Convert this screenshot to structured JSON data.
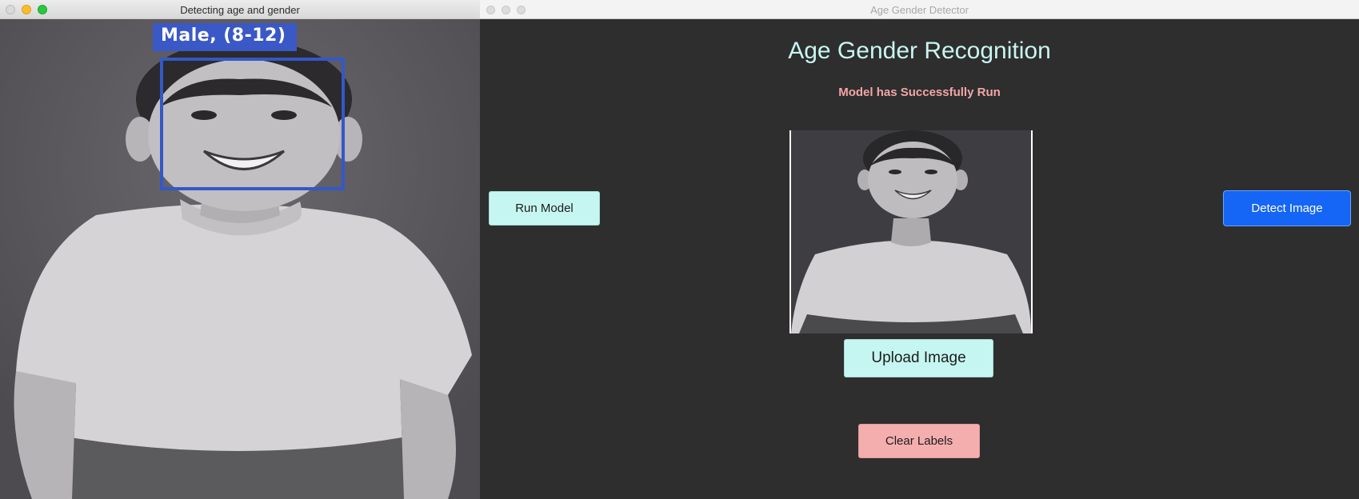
{
  "left_window": {
    "title": "Detecting age and gender",
    "detection_label": "Male, (8-12)",
    "colors": {
      "box": "#3358c8",
      "label_bg": "#3a58c6"
    }
  },
  "right_window": {
    "title": "Age Gender Detector",
    "heading": "Age Gender Recognition",
    "status": "Model has Successfully Run",
    "buttons": {
      "run_model": "Run Model",
      "upload_image": "Upload Image",
      "detect_image": "Detect Image",
      "clear_labels": "Clear Labels"
    },
    "colors": {
      "background": "#2e2e2e",
      "heading": "#c8f5f0",
      "status": "#f3a6a6",
      "teal_button": "#c6f6f1",
      "pink_button": "#f5aeae",
      "blue_button": "#1565f6"
    },
    "preview_image": "child-portrait"
  },
  "icons": [
    "window-close-icon",
    "window-minimize-icon",
    "window-maximize-icon"
  ]
}
